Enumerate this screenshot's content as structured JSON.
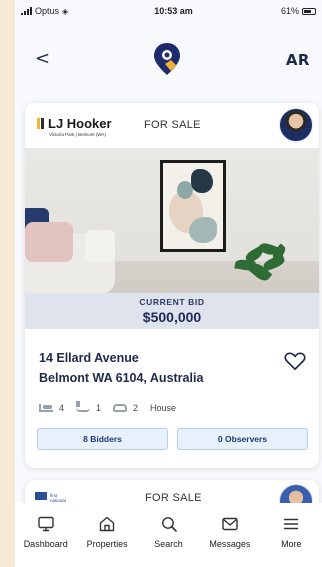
{
  "status_bar": {
    "carrier": "Optus",
    "time": "10:53 am",
    "battery": "61%"
  },
  "header": {
    "back_label": "<",
    "user_initials": "AR"
  },
  "listings": [
    {
      "agency": {
        "name": "LJ Hooker",
        "branch": "Victoria Park | Belmont (WA)"
      },
      "status": "FOR SALE",
      "bid": {
        "label": "CURRENT BID",
        "value": "$500,000"
      },
      "address_line1": "14 Ellard Avenue",
      "address_line2": "Belmont WA 6104, Australia",
      "features": {
        "beds": "4",
        "baths": "1",
        "cars": "2",
        "type": "House"
      },
      "bidders_label": "8 Bidders",
      "observers_label": "0 Observers",
      "favorited": false
    },
    {
      "agency": {
        "name": "first national"
      },
      "status": "FOR SALE"
    }
  ],
  "tabs": [
    {
      "label": "Dashboard",
      "icon": "monitor-icon"
    },
    {
      "label": "Properties",
      "icon": "house-icon"
    },
    {
      "label": "Search",
      "icon": "search-icon"
    },
    {
      "label": "Messages",
      "icon": "envelope-icon"
    },
    {
      "label": "More",
      "icon": "menu-icon"
    }
  ],
  "colors": {
    "navy": "#1e2a4a",
    "gold": "#f2b233",
    "accent_blue": "#2b4d9a",
    "bid_band": "#dfe3ee"
  }
}
